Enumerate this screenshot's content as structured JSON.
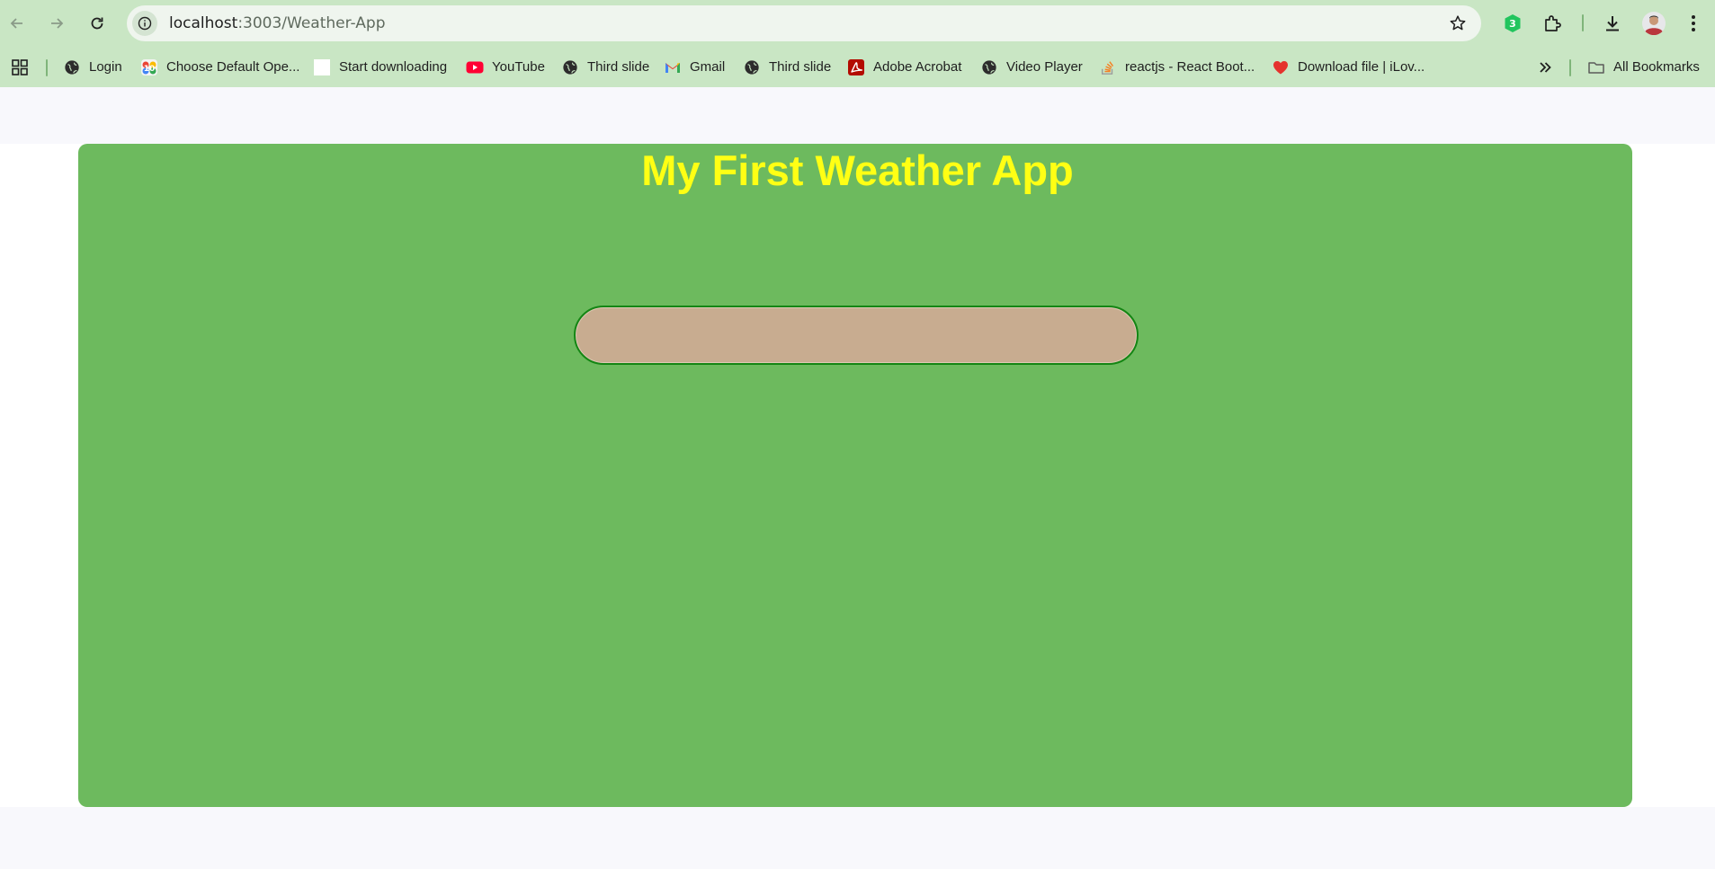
{
  "browser": {
    "url_host": "localhost",
    "url_path": ":3003/Weather-App",
    "bookmarks": [
      {
        "label": "Login",
        "icon": "globe-icon"
      },
      {
        "label": "Choose Default Ope...",
        "icon": "app-icon"
      },
      {
        "label": "Start downloading",
        "icon": "blank-page-icon"
      },
      {
        "label": "YouTube",
        "icon": "youtube-icon"
      },
      {
        "label": "Third slide",
        "icon": "globe-icon"
      },
      {
        "label": "Gmail",
        "icon": "gmail-icon"
      },
      {
        "label": "Third slide",
        "icon": "globe-icon"
      },
      {
        "label": "Adobe Acrobat",
        "icon": "acrobat-icon"
      },
      {
        "label": "Video Player",
        "icon": "globe-icon"
      },
      {
        "label": "reactjs - React Boot...",
        "icon": "stackoverflow-icon"
      },
      {
        "label": "Download file | iLov...",
        "icon": "ilovepdf-icon"
      }
    ],
    "all_bookmarks_label": "All Bookmarks"
  },
  "app": {
    "title": "My First Weather App",
    "search_value": "",
    "search_placeholder": ""
  },
  "colors": {
    "chrome": "#c9e6c4",
    "card": "#6dba5e",
    "title": "#ffff14",
    "search_fill": "#c8ac90",
    "search_border": "#148614"
  }
}
